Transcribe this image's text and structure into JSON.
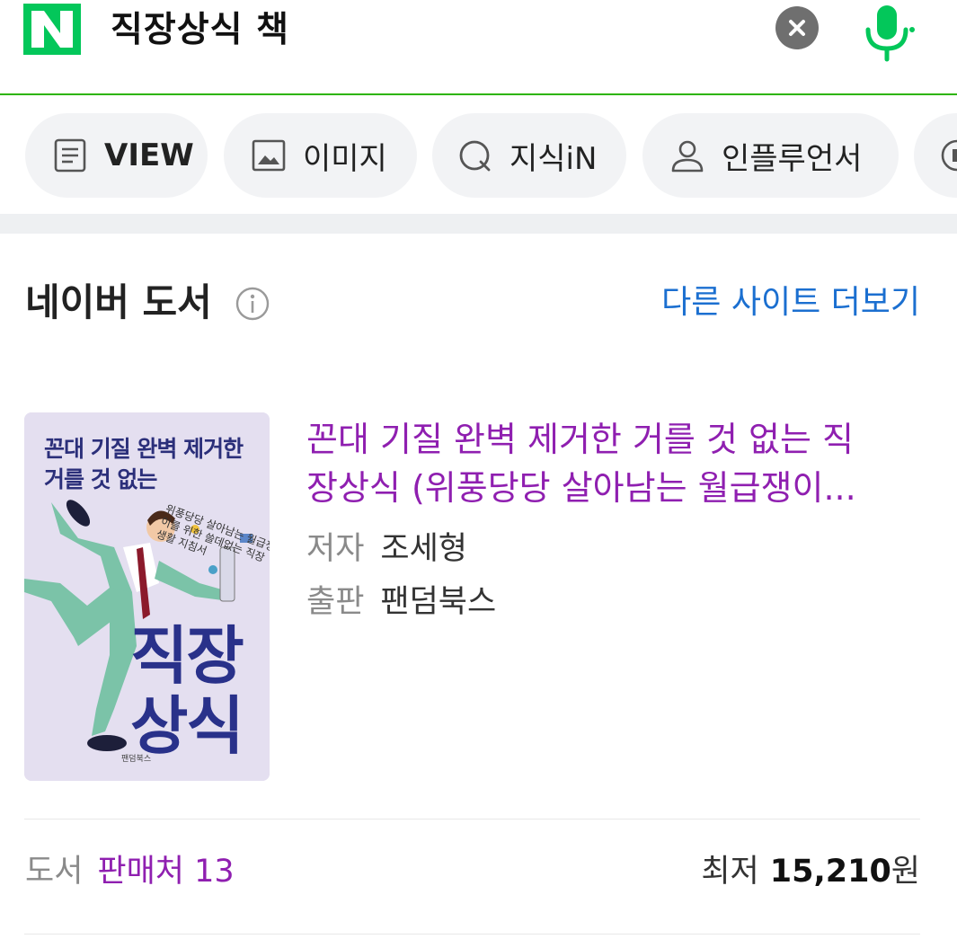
{
  "search": {
    "logo_letter": "N",
    "query": "직장상식 책"
  },
  "tabs": [
    {
      "label": "VIEW",
      "icon": "document-icon"
    },
    {
      "label": "이미지",
      "icon": "image-icon"
    },
    {
      "label": "지식iN",
      "icon": "q-icon"
    },
    {
      "label": "인플루언서",
      "icon": "person-icon"
    },
    {
      "label": "",
      "icon": "more-icon"
    }
  ],
  "section": {
    "title": "네이버 도서",
    "more_link": "다른 사이트 더보기"
  },
  "book": {
    "title_line1": "꼰대 기질 완벽 제거한 거를 것 없는 직",
    "title_line2": "장상식 (위풍당당 살아남는 월급쟁이...",
    "author_label": "저자",
    "author": "조세형",
    "publisher_label": "출판",
    "publisher": "팬덤북스",
    "cover": {
      "top_text_1": "꼰대 기질 완벽 제거한",
      "top_text_2": "거를 것 없는",
      "tagline": "위풍당당 살아남는 월급쟁이를 위한 쓸데없는 직장생활 지침서",
      "big_text_1": "직장",
      "big_text_2": "상식",
      "publisher_mark": "팬덤북스"
    }
  },
  "footer": {
    "category_label": "도서",
    "sellers": "판매처 13",
    "price_label": "최저",
    "price": "15,210",
    "currency": "원"
  },
  "colors": {
    "naver_green": "#03c75a",
    "link_blue": "#1b6fd0",
    "title_purple": "#8f1fb0"
  }
}
